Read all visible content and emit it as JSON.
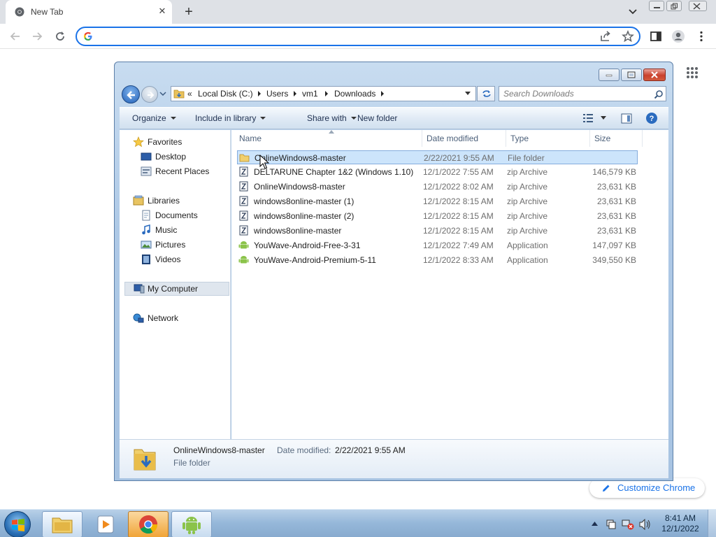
{
  "chrome": {
    "tab_title": "New Tab",
    "omnibox_placeholder": "",
    "customize_label": "Customize Chrome"
  },
  "explorer": {
    "breadcrumb": {
      "overflow": "«",
      "items": [
        "Local Disk (C:)",
        "Users",
        "vm1",
        "Downloads"
      ]
    },
    "search_placeholder": "Search Downloads",
    "commands": {
      "organize": "Organize",
      "include_in_library": "Include in library",
      "share_with": "Share with",
      "new_folder": "New folder"
    },
    "nav": {
      "favorites": "Favorites",
      "desktop": "Desktop",
      "recent_places": "Recent Places",
      "libraries": "Libraries",
      "documents": "Documents",
      "music": "Music",
      "pictures": "Pictures",
      "videos": "Videos",
      "my_computer": "My Computer",
      "network": "Network"
    },
    "columns": {
      "name": "Name",
      "date_modified": "Date modified",
      "type": "Type",
      "size": "Size"
    },
    "files": [
      {
        "name": "OnlineWindows8-master",
        "date": "2/22/2021 9:55 AM",
        "type": "File folder",
        "size": "",
        "icon": "folder-icon"
      },
      {
        "name": "DELTARUNE Chapter 1&2 (Windows 1.10)",
        "date": "12/1/2022 7:55 AM",
        "type": "zip Archive",
        "size": "146,579 KB",
        "icon": "zip-icon"
      },
      {
        "name": "OnlineWindows8-master",
        "date": "12/1/2022 8:02 AM",
        "type": "zip Archive",
        "size": "23,631 KB",
        "icon": "zip-icon"
      },
      {
        "name": "windows8online-master (1)",
        "date": "12/1/2022 8:15 AM",
        "type": "zip Archive",
        "size": "23,631 KB",
        "icon": "zip-icon"
      },
      {
        "name": "windows8online-master (2)",
        "date": "12/1/2022 8:15 AM",
        "type": "zip Archive",
        "size": "23,631 KB",
        "icon": "zip-icon"
      },
      {
        "name": "windows8online-master",
        "date": "12/1/2022 8:15 AM",
        "type": "zip Archive",
        "size": "23,631 KB",
        "icon": "zip-icon"
      },
      {
        "name": "YouWave-Android-Free-3-31",
        "date": "12/1/2022 7:49 AM",
        "type": "Application",
        "size": "147,097 KB",
        "icon": "android-app-icon"
      },
      {
        "name": "YouWave-Android-Premium-5-11",
        "date": "12/1/2022 8:33 AM",
        "type": "Application",
        "size": "349,550 KB",
        "icon": "android-app-icon"
      }
    ],
    "details": {
      "name": "OnlineWindows8-master",
      "date_label": "Date modified:",
      "date_value": "2/22/2021 9:55 AM",
      "type": "File folder"
    }
  },
  "taskbar": {
    "time": "8:41 AM",
    "date": "12/1/2022"
  },
  "colors": {
    "chrome_accent": "#1a73e8",
    "selection": "#cce4fb",
    "taskbar": "#95b7d9"
  }
}
